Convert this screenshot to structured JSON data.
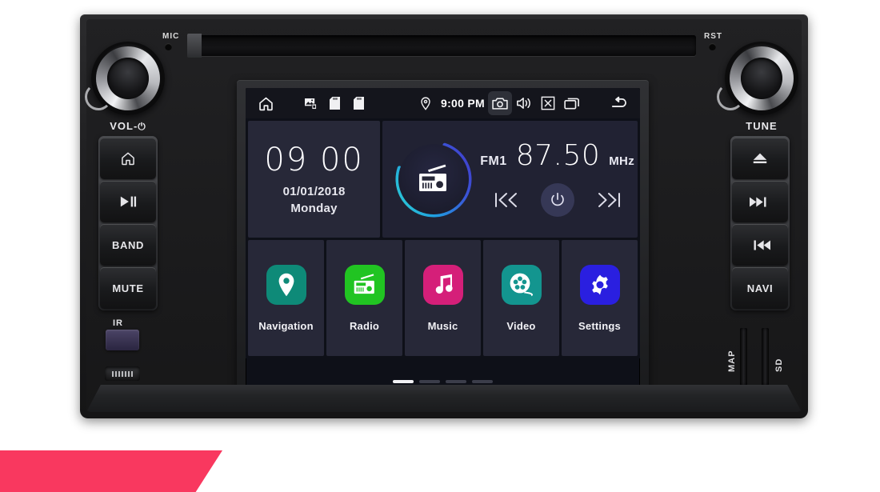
{
  "device": {
    "top_labels": {
      "mic": "MIC",
      "rst": "RST"
    },
    "left_knob": {
      "label": "VOL-",
      "power_glyph": "⏻"
    },
    "right_knob": {
      "label": "TUNE"
    },
    "left_buttons": [
      {
        "name": "home",
        "label": "",
        "icon": "home-icon"
      },
      {
        "name": "play-pause",
        "label": "",
        "icon": "play-pause-icon"
      },
      {
        "name": "band",
        "label": "BAND",
        "icon": ""
      },
      {
        "name": "mute",
        "label": "MUTE",
        "icon": ""
      }
    ],
    "right_buttons": [
      {
        "name": "eject",
        "label": "",
        "icon": "eject-icon"
      },
      {
        "name": "next-track",
        "label": "",
        "icon": "next-track-icon"
      },
      {
        "name": "prev-track",
        "label": "",
        "icon": "prev-track-icon"
      },
      {
        "name": "navi",
        "label": "NAVI",
        "icon": ""
      }
    ],
    "ir_label": "IR",
    "usb_glyph": "⑂",
    "card_slots": [
      {
        "label": "MAP"
      },
      {
        "label": "SD"
      }
    ]
  },
  "statusbar": {
    "home_icon": "home-icon",
    "left_icons": [
      "screenshot-icon",
      "sd-card-icon",
      "sd-card-icon"
    ],
    "location_icon": "location-pin-icon",
    "time": "9:00 PM",
    "right_icons": [
      "camera-icon",
      "volume-icon",
      "close-icon",
      "recent-apps-icon"
    ],
    "back_icon": "back-icon"
  },
  "clock_widget": {
    "hours": "09",
    "minutes": "00",
    "separator": " ",
    "date": "01/01/2018",
    "weekday": "Monday"
  },
  "radio_widget": {
    "icon": "radio-icon",
    "band": "FM1",
    "frequency": "87.50",
    "unit": "MHz",
    "prev_label": "prev-station",
    "power_label": "power",
    "next_label": "next-station",
    "ring_color_start": "#23c7cf",
    "ring_color_end": "#3b46cf"
  },
  "tiles": [
    {
      "label": "Navigation",
      "icon": "location-pin-icon",
      "color": "#0e8a78"
    },
    {
      "label": "Radio",
      "icon": "radio-icon",
      "color": "#21c422"
    },
    {
      "label": "Music",
      "icon": "music-note-icon",
      "color": "#d51f79"
    },
    {
      "label": "Video",
      "icon": "film-reel-icon",
      "color": "#13958f"
    },
    {
      "label": "Settings",
      "icon": "gear-icon",
      "color": "#2a1fe0"
    }
  ],
  "pager": {
    "pages": 4,
    "active": 1
  },
  "colors": {
    "banner": "#f9385f",
    "screen_bg": "#0e1018",
    "tile_bg": "#272838",
    "statusbar_bg": "#14151c"
  }
}
